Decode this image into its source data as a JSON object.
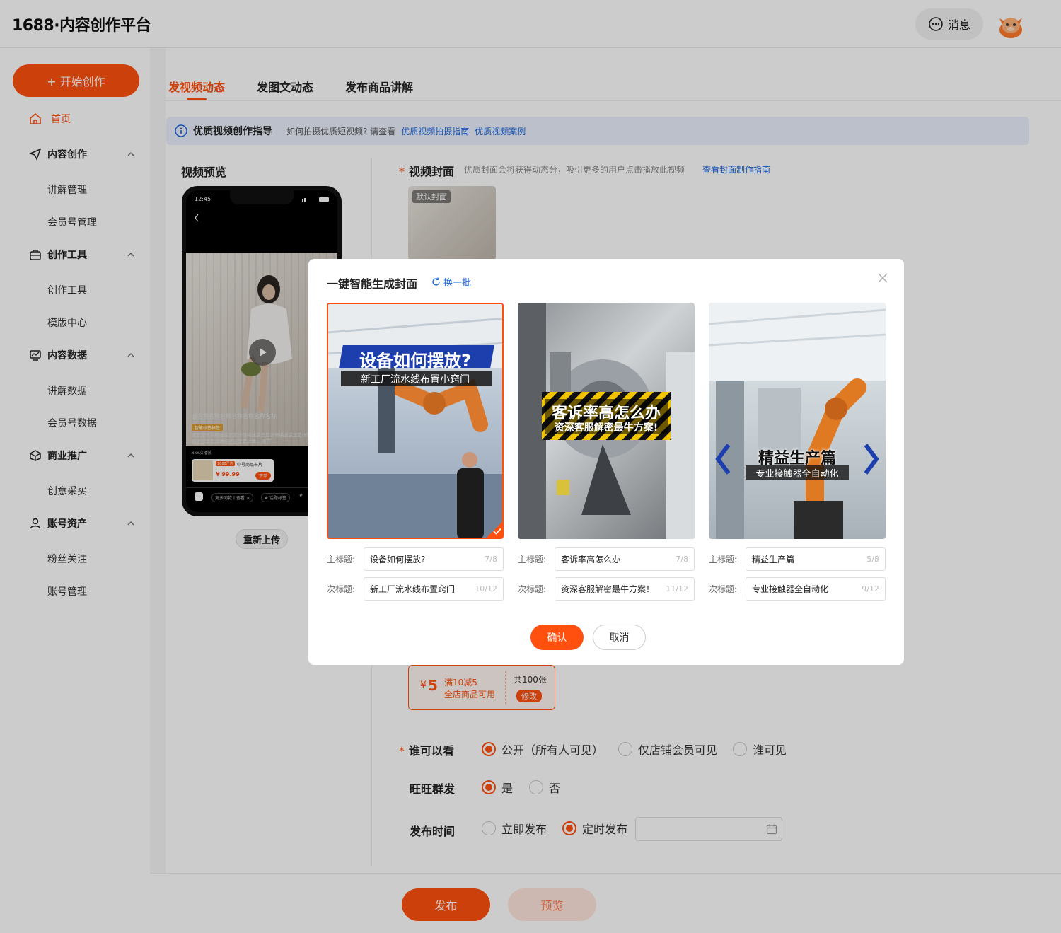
{
  "header": {
    "logo": "1688·内容创作平台",
    "messages_label": "消息"
  },
  "sidebar": {
    "start_button": "+ 开始创作",
    "home": "首页",
    "groups": [
      {
        "label": "内容创作",
        "items": [
          "讲解管理",
          "会员号管理"
        ]
      },
      {
        "label": "创作工具",
        "items": [
          "创作工具",
          "模版中心"
        ]
      },
      {
        "label": "内容数据",
        "items": [
          "讲解数据",
          "会员号数据"
        ]
      },
      {
        "label": "商业推广",
        "items": [
          "创意采买"
        ]
      },
      {
        "label": "账号资产",
        "items": [
          "粉丝关注",
          "账号管理"
        ]
      }
    ]
  },
  "tabs": [
    "发视频动态",
    "发图文动态",
    "发布商品讲解"
  ],
  "guide": {
    "title": "优质视频创作指导",
    "text": "如何拍摄优质短视频? 请查看",
    "link1": "优质视频拍摄指南",
    "link2": "优质视频案例"
  },
  "preview": {
    "title": "视频预览",
    "time": "12:45",
    "author": "@名称名称名称名称名称名称名称",
    "tag": "智能标签标签",
    "desc": "这里是详情描述这里是详情描述这里是详情描述这里是详情描述这里是详情描述这里是详情...  展开",
    "plays": "xxx次播放",
    "product_tag": "1688严选",
    "product_name": "中号商品卡片",
    "price": "¥ 99.99",
    "buy": "下单",
    "bottom_tabs": [
      "更多同款丨查看 >",
      "# 话题标签",
      "#"
    ],
    "reupload": "重新上传"
  },
  "cover": {
    "label": "视频封面",
    "hint": "优质封面会将获得动态分，吸引更多的用户点击播放此视频",
    "link": "查看封面制作指南",
    "default_label": "默认封面"
  },
  "coupon": {
    "amount": "5",
    "currency": "¥",
    "rule": "满10减5",
    "scope": "全店商品可用",
    "total": "共100张",
    "edit": "修改"
  },
  "visibility": {
    "label": "谁可以看",
    "options": [
      "公开（所有人可见）",
      "仅店铺会员可见",
      "谁可见"
    ],
    "selected": 0
  },
  "wangwang": {
    "label": "旺旺群发",
    "options": [
      "是",
      "否"
    ],
    "selected": 0
  },
  "publish_time": {
    "label": "发布时间",
    "options": [
      "立即发布",
      "定时发布"
    ],
    "selected": 1
  },
  "actions": {
    "publish": "发布",
    "preview": "预览"
  },
  "modal": {
    "title": "一键智能生成封面",
    "refresh": "换一批",
    "main_label": "主标题:",
    "sub_label": "次标题:",
    "covers": [
      {
        "main": "设备如何摆放?",
        "main_count": "7/8",
        "sub": "新工厂流水线布置窍门",
        "sub_count": "10/12",
        "cap_main": "设备如何摆放?",
        "cap_sub": "新工厂流水线布置小窍门",
        "selected": true
      },
      {
        "main": "客诉率高怎么办",
        "main_count": "7/8",
        "sub": "资深客服解密最牛方案！",
        "sub_count": "11/12",
        "cap_main": "客诉率高怎么办",
        "cap_sub": "资深客服解密最牛方案!",
        "selected": false
      },
      {
        "main": "精益生产篇",
        "main_count": "5/8",
        "sub": "专业接触器全自动化",
        "sub_count": "9/12",
        "cap_main": "精益生产篇",
        "cap_sub": "专业接触器全自动化",
        "selected": false
      }
    ],
    "confirm": "确认",
    "cancel": "取消"
  },
  "colors": {
    "accent": "#ff5010",
    "link": "#1a66e0",
    "guide_bg": "#eaf1fd"
  }
}
